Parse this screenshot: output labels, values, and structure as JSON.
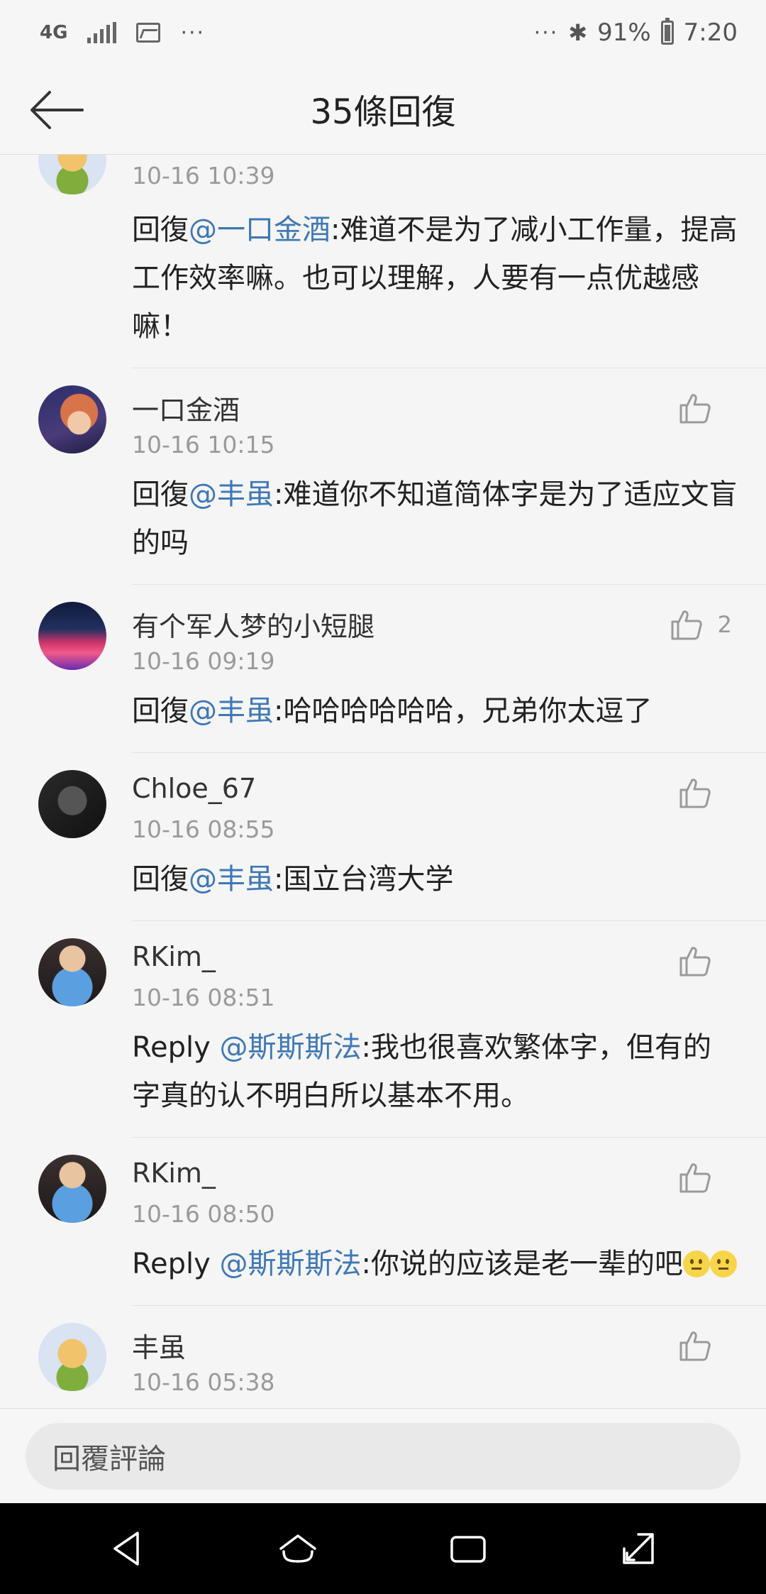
{
  "status_bar": {
    "network": "4G",
    "dots_left": "···",
    "dots_right": "···",
    "bluetooth": "✱",
    "battery_percent": "91%",
    "time": "7:20"
  },
  "header": {
    "title": "35條回復"
  },
  "comments": [
    {
      "name": "",
      "time": "10-16 10:39",
      "prefix": "回復",
      "mention": "@一口金酒",
      "body": ":难道不是为了减小工作量，提高工作效率嘛。也可以理解，人要有一点优越感嘛！",
      "likes": ""
    },
    {
      "name": "一口金酒",
      "time": "10-16 10:15",
      "prefix": "回復",
      "mention": "@丰虽",
      "body": ":难道你不知道简体字是为了适应文盲的吗",
      "likes": ""
    },
    {
      "name": "有个军人梦的小短腿",
      "time": "10-16 09:19",
      "prefix": "回復",
      "mention": "@丰虽",
      "body": ":哈哈哈哈哈哈，兄弟你太逗了",
      "likes": "2"
    },
    {
      "name": "Chloe_67",
      "time": "10-16 08:55",
      "prefix": "回復",
      "mention": "@丰虽",
      "body": ":国立台湾大学",
      "likes": ""
    },
    {
      "name": "RKim_",
      "time": "10-16 08:51",
      "prefix": "Reply ",
      "mention": "@斯斯斯法",
      "body": ":我也很喜欢繁体字，但有的字真的认不明白所以基本不用。",
      "likes": ""
    },
    {
      "name": "RKim_",
      "time": "10-16 08:50",
      "prefix": "Reply ",
      "mention": "@斯斯斯法",
      "body": ":你说的应该是老一辈的吧",
      "likes": ""
    },
    {
      "name": "丰虽",
      "time": "10-16 05:38",
      "prefix": "",
      "mention": "",
      "body": "",
      "likes": ""
    }
  ],
  "reply_bar": {
    "placeholder": "回覆評論"
  },
  "colors": {
    "mention": "#3f78b5",
    "timestamp": "#9a9a9a",
    "background": "#f5f5f5"
  }
}
